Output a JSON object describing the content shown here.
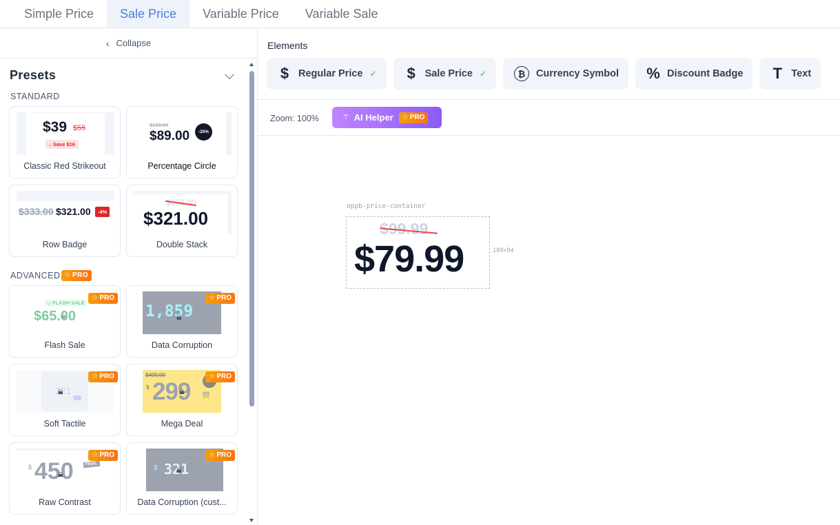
{
  "tabs": [
    "Simple Price",
    "Sale Price",
    "Variable Price",
    "Variable Sale"
  ],
  "active_tab": "Sale Price",
  "sidebar": {
    "collapse_label": "Collapse",
    "presets_title": "Presets",
    "standard_label": "STANDARD",
    "advanced_label": "ADVANCED",
    "pro_label": "PRO",
    "standard_presets": [
      {
        "name": "Classic Red Strikeout",
        "price": "$39",
        "old": "$55",
        "save": "Save $16"
      },
      {
        "name": "Percentage Circle",
        "price": "$89.00",
        "old": "$120.00",
        "badge": "-25%"
      },
      {
        "name": "Row Badge",
        "price": "$321.00",
        "old": "$333.00",
        "badge": "-4%"
      },
      {
        "name": "Double Stack",
        "price": "$321.00",
        "old": "$333.00"
      }
    ],
    "advanced_presets": [
      {
        "name": "Flash Sale",
        "price": "$65.00",
        "tag": "FLASH SALE"
      },
      {
        "name": "Data Corruption",
        "price": "1,859"
      },
      {
        "name": "Soft Tactile",
        "price": "321"
      },
      {
        "name": "Mega Deal",
        "price": "299",
        "old": "$499.00",
        "cents": "99"
      },
      {
        "name": "Raw Contrast",
        "price": "450",
        "tag": "FINAL"
      },
      {
        "name": "Data Corruption (cust...",
        "price": "321"
      }
    ]
  },
  "main": {
    "elements_label": "Elements",
    "elements": [
      {
        "label": "Regular Price",
        "icon": "$",
        "checked": true
      },
      {
        "label": "Sale Price",
        "icon": "$",
        "checked": true
      },
      {
        "label": "Currency Symbol",
        "icon": "₿",
        "checked": false
      },
      {
        "label": "Discount Badge",
        "icon": "%",
        "checked": false
      },
      {
        "label": "Text",
        "icon": "T",
        "checked": false
      }
    ],
    "zoom_label": "Zoom: 100%",
    "ai_helper_label": "AI Helper",
    "canvas": {
      "container_label": "oppb-price-container",
      "regular_price": "$99.99",
      "sale_price": "$79.99",
      "dimensions": "189×94"
    }
  },
  "colors": {
    "accent": "#4f7fd6",
    "pro_gradient": [
      "#f59e0b",
      "#f97316"
    ],
    "ai_gradient": [
      "#c084fc",
      "#8b5cf6"
    ],
    "strike": "#ef4444"
  }
}
